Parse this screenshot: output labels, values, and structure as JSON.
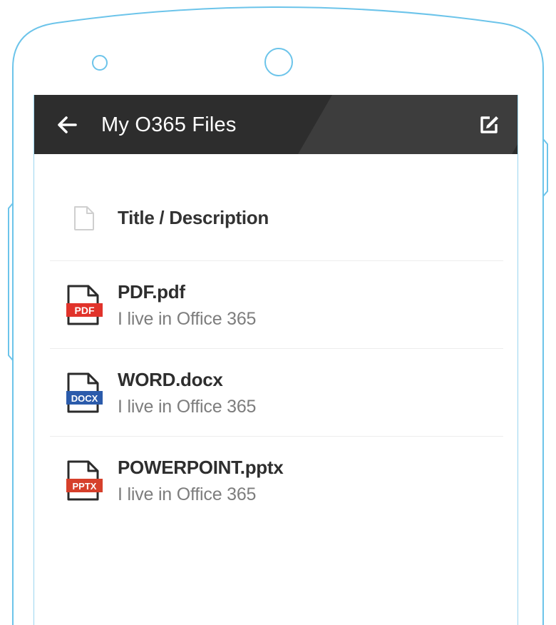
{
  "appbar": {
    "title": "My O365 Files",
    "back_icon": "arrow-left-icon",
    "edit_icon": "edit-icon"
  },
  "list": {
    "header_label": "Title / Description",
    "header_icon": "document-icon",
    "items": [
      {
        "name": "PDF.pdf",
        "description": "I live in Office 365",
        "badge": "PDF",
        "badge_color": "#e1332b",
        "icon": "pdf-file-icon"
      },
      {
        "name": "WORD.docx",
        "description": "I live in Office 365",
        "badge": "DOCX",
        "badge_color": "#2b5bab",
        "icon": "word-file-icon"
      },
      {
        "name": "POWERPOINT.pptx",
        "description": "I live in Office 365",
        "badge": "PPTX",
        "badge_color": "#d6402b",
        "icon": "powerpoint-file-icon"
      }
    ]
  },
  "colors": {
    "appbar_bg": "#2d2d2d",
    "phone_outline": "#6cc4ea",
    "divider": "#ececec"
  }
}
